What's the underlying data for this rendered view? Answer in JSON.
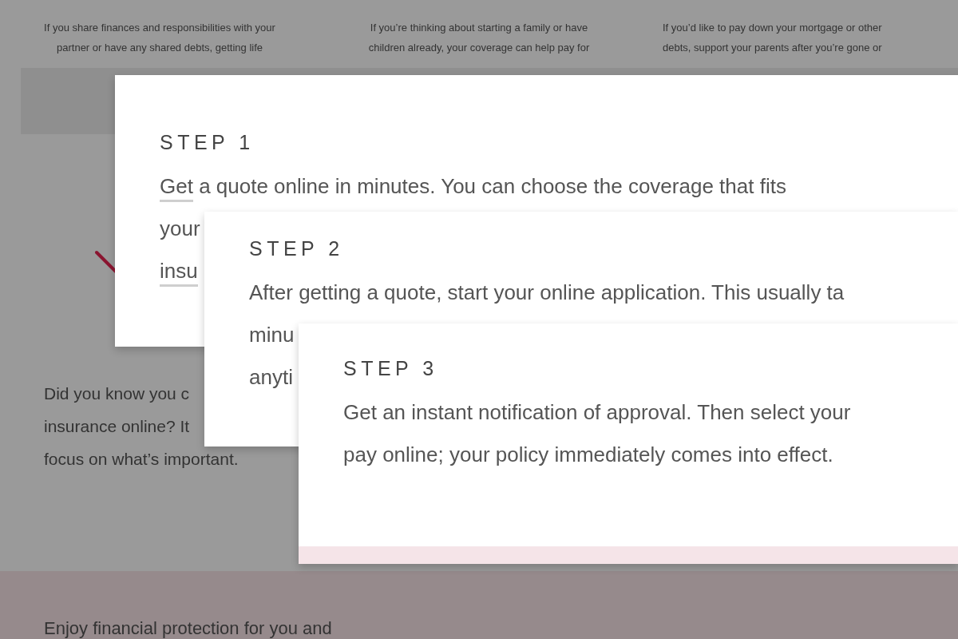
{
  "background": {
    "columns": [
      {
        "lines": [
          "If you share finances and responsibilities with your",
          "partner or have any shared debts, getting life"
        ]
      },
      {
        "lines": [
          "If you’re thinking about starting a family or have",
          "children already, your coverage can help pay for"
        ]
      },
      {
        "lines": [
          "If you’d like to pay down your mortgage or other",
          "debts, support your parents after you’re gone or"
        ]
      }
    ],
    "intro_lines": [
      "Did you know you c",
      "insurance online? It",
      "focus on what’s important."
    ],
    "footer_heading": "Enjoy financial protection for you and"
  },
  "steps": [
    {
      "title": "STEP 1",
      "lines": [
        [
          {
            "text": "Get",
            "link": true
          },
          {
            "text": " a quote online in minutes. You can choose the coverage that fits",
            "link": false
          }
        ],
        [
          {
            "text": "your",
            "link": false
          }
        ],
        [
          {
            "text": "insu",
            "link": true
          }
        ]
      ],
      "pink_strip": false
    },
    {
      "title": "STEP 2",
      "lines": [
        [
          {
            "text": "After getting a quote, start your online application. This usually ta",
            "link": false
          }
        ],
        [
          {
            "text": "minu",
            "link": false
          }
        ],
        [
          {
            "text": "anyti",
            "link": false
          }
        ]
      ],
      "pink_strip": false
    },
    {
      "title": "STEP 3",
      "lines": [
        [
          {
            "text": "Get an instant notification of approval. Then select your",
            "link": false
          }
        ],
        [
          {
            "text": "pay online; your policy immediately comes into effect.",
            "link": false
          }
        ]
      ],
      "pink_strip": true
    }
  ]
}
